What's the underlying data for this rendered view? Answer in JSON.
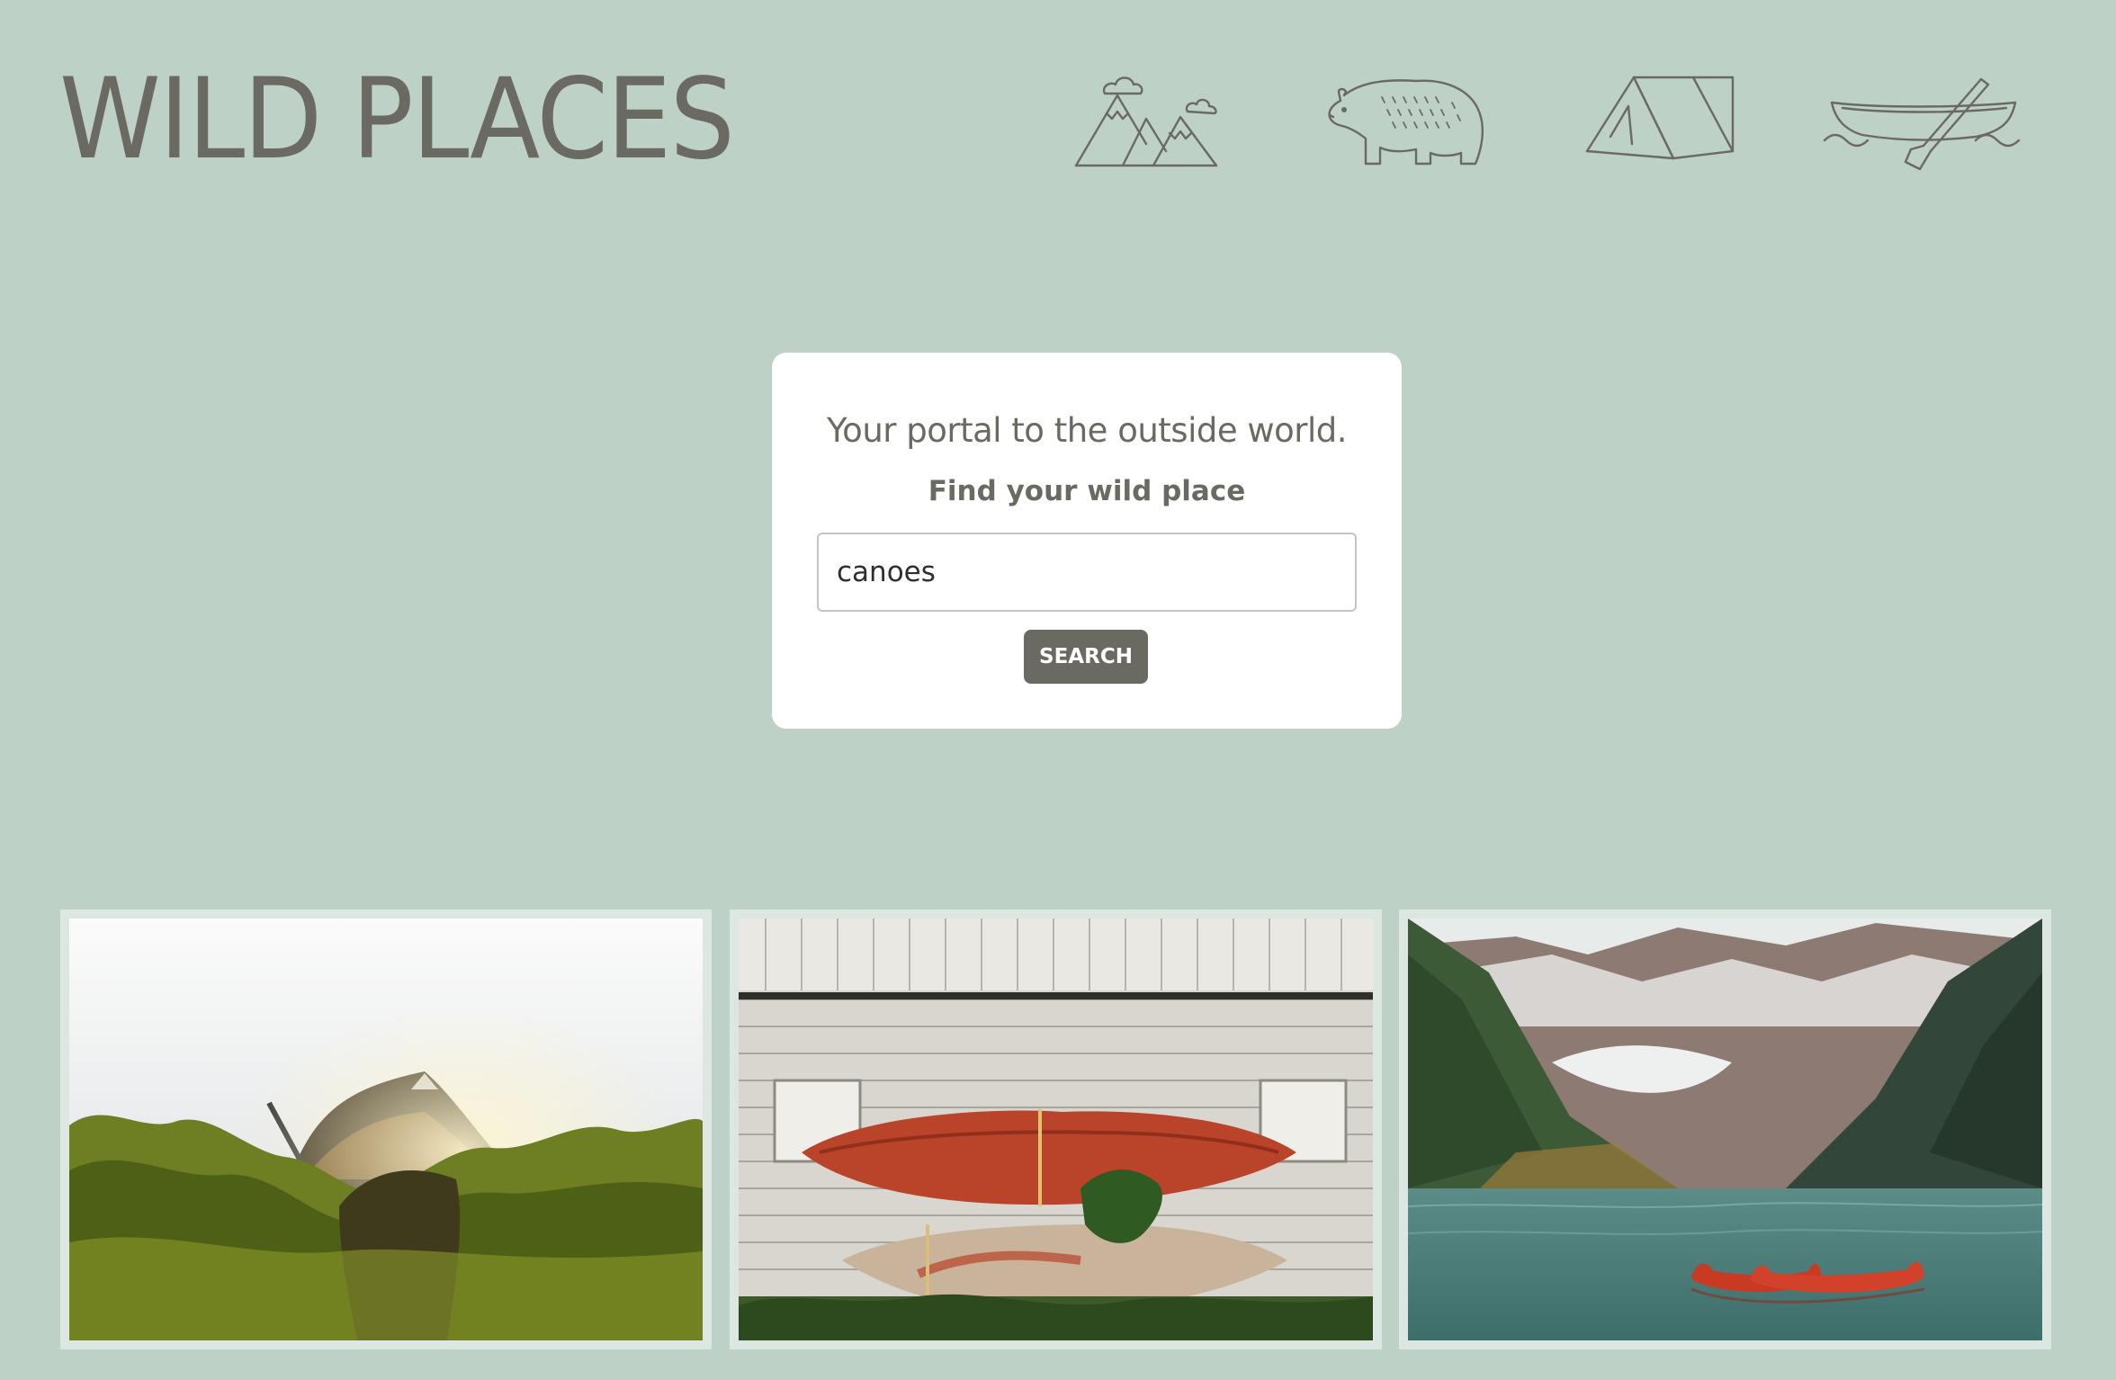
{
  "header": {
    "logo_text": "WILD PLACES",
    "nav_icons": [
      "mountains-icon",
      "bear-icon",
      "tent-icon",
      "canoe-icon"
    ]
  },
  "search": {
    "tagline": "Your portal to the outside world.",
    "label": "Find your wild place",
    "query": "canoes",
    "button_label": "SEARCH"
  },
  "results": {
    "images": [
      "canoe-in-bushes-photo",
      "kayaks-against-barn-photo",
      "canoes-on-mountain-lake-photo"
    ]
  },
  "colors": {
    "background": "#bdd1c7",
    "text": "#6b6a62",
    "card": "#ffffff",
    "button": "#6b6a62",
    "photo_border": "#dce7e1"
  }
}
